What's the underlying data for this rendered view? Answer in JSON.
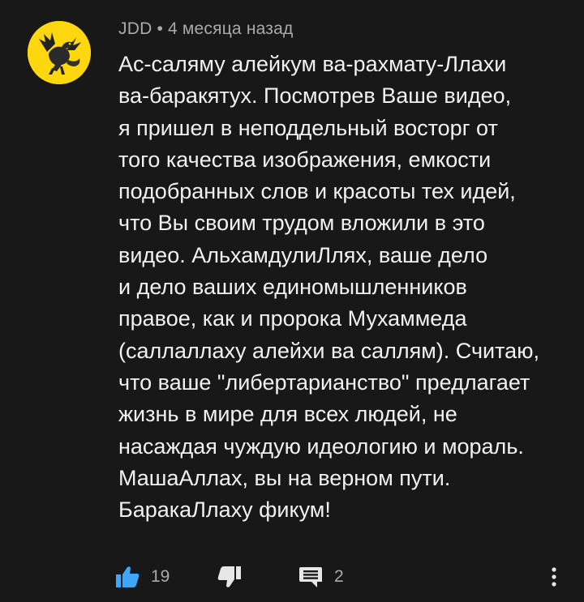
{
  "comment": {
    "author": "JDD",
    "separator": "•",
    "time": "4 месяца назад",
    "lines": [
      "Ас-саляму алейкум ва-рахмату-Ллахи",
      "ва-баракятух. Посмотрев Ваше видео,",
      "я пришел в неподдельный восторг от",
      "того качества изображения, емкости",
      "подобранных слов и красоты тех идей,",
      "что Вы своим трудом вложили в это",
      "видео. АльхамдулиЛлях, ваше дело",
      "и дело ваших единомышленников",
      "правое, как и пророка Мухаммеда",
      "(саллаллаху алейхи ва саллям). Считаю,",
      "что ваше \"либертарианство\" предлагает",
      "жизнь в мире для всех людей, не",
      "насаждая чуждую идеологию и мораль.",
      "МашаАллах, вы на верном пути.",
      "БаракаЛлаху фикум!"
    ]
  },
  "actions": {
    "likes": "19",
    "replies": "2"
  },
  "icons": {
    "avatar": "dragon-avatar-icon",
    "like": "thumbs-up-icon",
    "dislike": "thumbs-down-icon",
    "reply": "reply-icon",
    "more": "more-vert-icon"
  },
  "colors": {
    "background": "#181818",
    "text": "#f1f1f1",
    "secondary": "#aaaaaa",
    "like_active": "#3ea6ff",
    "avatar_bg": "#ffd70f"
  }
}
